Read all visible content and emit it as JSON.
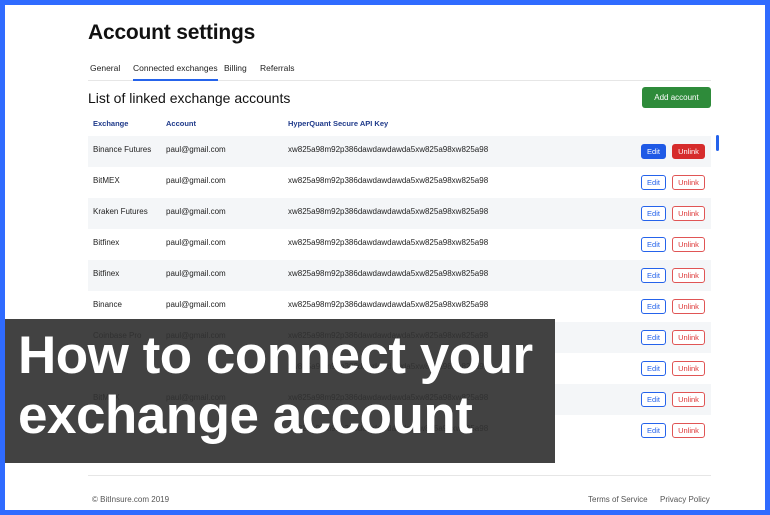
{
  "page": {
    "title": "Account settings",
    "tabs": [
      {
        "label": "General"
      },
      {
        "label": "Connected exchanges",
        "active": true
      },
      {
        "label": "Billing"
      },
      {
        "label": "Referrals"
      }
    ],
    "section_title": "List of linked exchange accounts",
    "add_button": "Add account"
  },
  "table": {
    "headers": [
      "Exchange",
      "Account",
      "HyperQuant Secure API Key"
    ],
    "edit_label": "Edit",
    "unlink_label": "Unlink",
    "rows": [
      {
        "exchange": "Binance Futures",
        "account": "paul@gmail.com",
        "key": "xw825a98m92p386dawdawdawda5xw825a98xw825a98"
      },
      {
        "exchange": "BitMEX",
        "account": "paul@gmail.com",
        "key": "xw825a98m92p386dawdawdawda5xw825a98xw825a98"
      },
      {
        "exchange": "Kraken Futures",
        "account": "paul@gmail.com",
        "key": "xw825a98m92p386dawdawdawda5xw825a98xw825a98"
      },
      {
        "exchange": "Bitfinex",
        "account": "paul@gmail.com",
        "key": "xw825a98m92p386dawdawdawda5xw825a98xw825a98"
      },
      {
        "exchange": "Bitfinex",
        "account": "paul@gmail.com",
        "key": "xw825a98m92p386dawdawdawda5xw825a98xw825a98"
      },
      {
        "exchange": "Binance",
        "account": "paul@gmail.com",
        "key": "xw825a98m92p386dawdawdawda5xw825a98xw825a98"
      },
      {
        "exchange": "Coinbase Pro",
        "account": "paul@gmail.com",
        "key": "xw825a98m92p386dawdawdawda5xw825a98xw825a98"
      },
      {
        "exchange": "",
        "account": "",
        "key": "xw825a98m92p386dawdawdawda5xw825a98xw825a98"
      },
      {
        "exchange": "BitMEX",
        "account": "paul@gmail.com",
        "key": "xw825a98m92p386dawdawdawda5xw825a98xw825a98"
      },
      {
        "exchange": "",
        "account": "",
        "key": "xw825a98m92p386dawdawdawda5xw825a98xw825a98"
      }
    ]
  },
  "footer": {
    "copyright": "© BitInsure.com 2019",
    "terms": "Terms of Service",
    "privacy": "Privacy Policy"
  },
  "overlay": {
    "line1": "How to connect your",
    "line2": "exchange account"
  },
  "colors": {
    "frame_border": "#2f6bff",
    "accent_blue": "#2563eb",
    "add_green": "#2e8b3a",
    "unlink_red": "#d62c2c",
    "overlay": "#323232"
  }
}
